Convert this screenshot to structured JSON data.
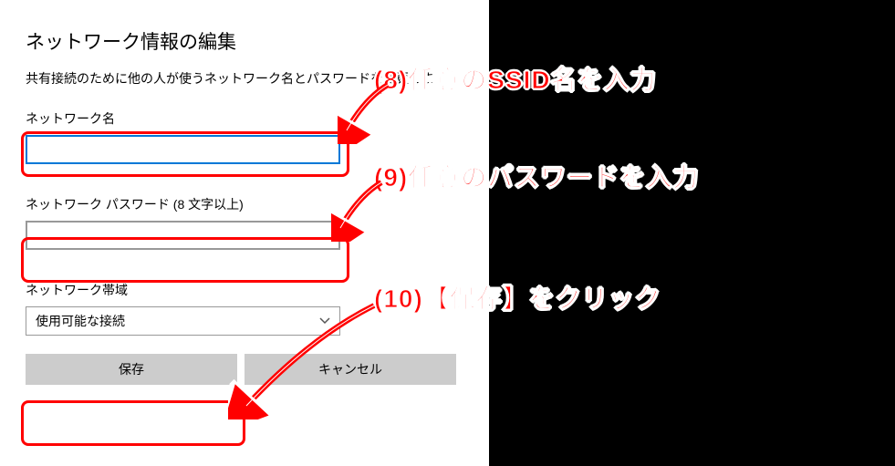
{
  "dialog": {
    "title": "ネットワーク情報の編集",
    "subtitle": "共有接続のために他の人が使うネットワーク名とパスワードを変更します。",
    "network_name_label": "ネットワーク名",
    "network_name_value": "",
    "password_label": "ネットワーク パスワード (8 文字以上)",
    "password_value": "",
    "band_label": "ネットワーク帯域",
    "band_selected": "使用可能な接続",
    "save_label": "保存",
    "cancel_label": "キャンセル"
  },
  "annotations": {
    "a1": "(8)任意のSSID名を入力",
    "a2": "(9)任意のパスワードを入力",
    "a3": "(10)【保存】をクリック"
  }
}
